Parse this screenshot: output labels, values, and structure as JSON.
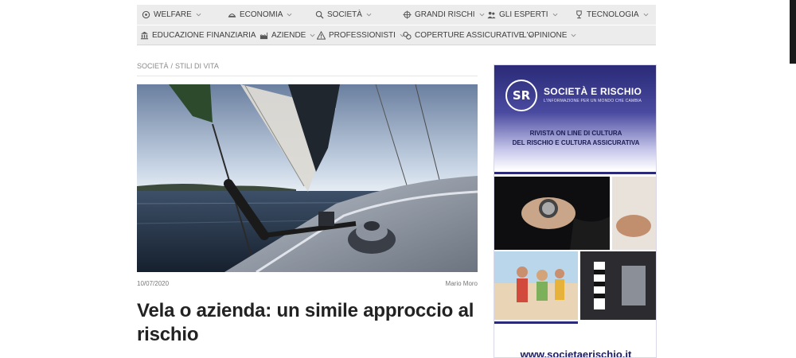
{
  "nav": {
    "row1": [
      {
        "label": "WELFARE",
        "icon": "welfare-icon"
      },
      {
        "label": "ECONOMIA",
        "icon": "economia-icon"
      },
      {
        "label": "SOCIETÀ",
        "icon": "search-icon"
      },
      {
        "label": "GRANDI RISCHI",
        "icon": "target-icon"
      },
      {
        "label": "GLI ESPERTI",
        "icon": "users-icon"
      },
      {
        "label": "TECNOLOGIA",
        "icon": "trophy-icon"
      }
    ],
    "row2": [
      {
        "label": "EDUCAZIONE FINANZIARIA",
        "icon": "bank-icon"
      },
      {
        "label": "AZIENDE",
        "icon": "industry-icon"
      },
      {
        "label": "PROFESSIONISTI",
        "icon": "warning-icon"
      },
      {
        "label": "COPERTURE ASSICURATIVE",
        "icon": "coins-icon"
      },
      {
        "label": "L'OPINIONE",
        "icon": ""
      }
    ]
  },
  "breadcrumb": {
    "level1": "SOCIETÀ",
    "separator": "/",
    "level2": "STILI DI VITA"
  },
  "article": {
    "date": "10/07/2020",
    "author": "Mario Moro",
    "title": "Vela o azienda: un simile approccio al rischio"
  },
  "ad": {
    "logo_text": "SR",
    "brand": "SOCIETÀ E RISCHIO",
    "tagline": "L'INFORMAZIONE PER UN MONDO CHE CAMBIA",
    "description_line1": "RIVISTA ON LINE DI CULTURA",
    "description_line2": "DEL RISCHIO E CULTURA ASSICURATIVA",
    "url": "www.societaerischio.it"
  },
  "colors": {
    "nav_bg": "#ececec",
    "nav_text": "#3e3e3e",
    "ad_blue": "#2a2a78",
    "headline": "#222222"
  }
}
